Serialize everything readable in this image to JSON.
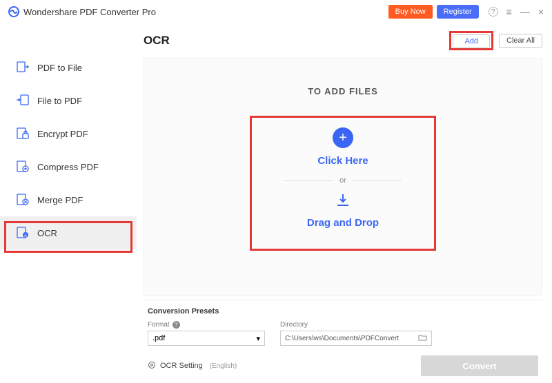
{
  "titlebar": {
    "app_name": "Wondershare PDF Converter Pro",
    "buy_now": "Buy Now",
    "register": "Register"
  },
  "sidebar": {
    "items": [
      {
        "label": "PDF to File"
      },
      {
        "label": "File to PDF"
      },
      {
        "label": "Encrypt PDF"
      },
      {
        "label": "Compress PDF"
      },
      {
        "label": "Merge PDF"
      },
      {
        "label": "OCR"
      }
    ]
  },
  "page": {
    "title": "OCR",
    "add": "Add",
    "clear_all": "Clear All"
  },
  "dropzone": {
    "to_add": "TO ADD FILES",
    "click_here": "Click Here",
    "or": "or",
    "drag_drop": "Drag and Drop"
  },
  "presets": {
    "title": "Conversion Presets",
    "format_label": "Format",
    "format_value": ".pdf",
    "directory_label": "Directory",
    "directory_value": "C:\\Users\\ws\\Documents\\PDFConvert"
  },
  "bottom": {
    "ocr_setting": "OCR Setting",
    "ocr_lang": "(English)",
    "convert": "Convert"
  }
}
